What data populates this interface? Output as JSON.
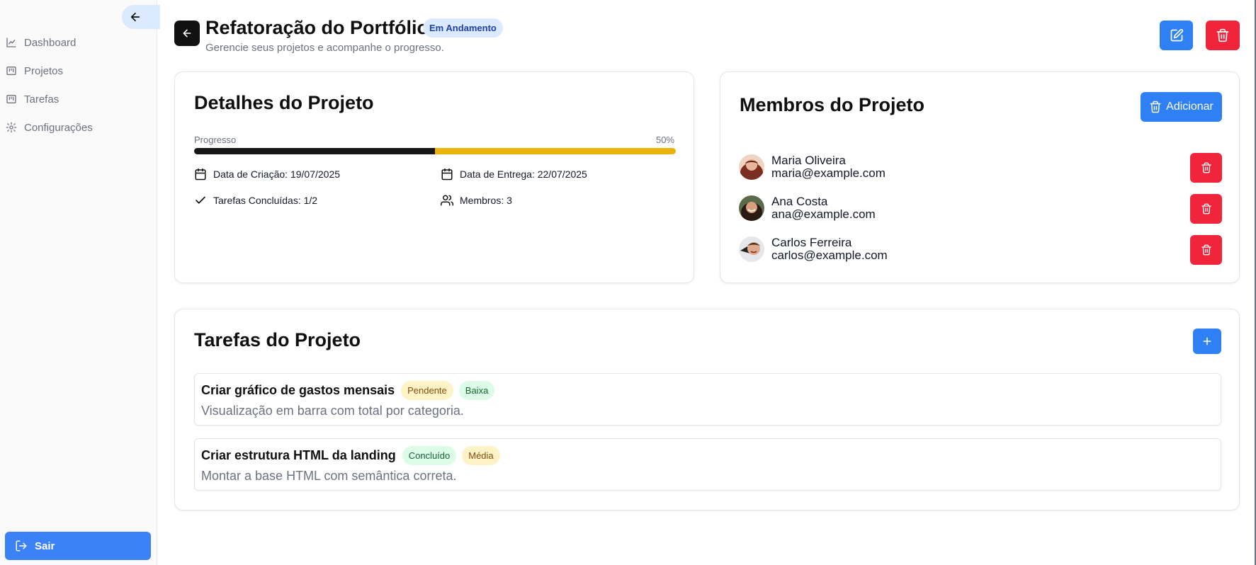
{
  "sidebar": {
    "items": [
      {
        "label": "Dashboard",
        "icon": "chart-line-icon"
      },
      {
        "label": "Projetos",
        "icon": "kanban-icon"
      },
      {
        "label": "Tarefas",
        "icon": "kanban-icon"
      },
      {
        "label": "Configurações",
        "icon": "gear-icon"
      }
    ],
    "logout_label": "Sair"
  },
  "header": {
    "title": "Refatoração do Portfólio",
    "status": "Em Andamento",
    "subtitle": "Gerencie seus projetos e acompanhe o progresso."
  },
  "details": {
    "title": "Detalhes do Projeto",
    "progress_label": "Progresso",
    "progress_text": "50%",
    "progress": 0.5,
    "created": "Data de Criação: 19/07/2025",
    "due": "Data de Entrega: 22/07/2025",
    "tasks_done": "Tarefas Concluídas: 1/2",
    "members": "Membros: 3"
  },
  "members": {
    "title": "Membros do Projeto",
    "add_label": "Adicionar",
    "list": [
      {
        "name": "Maria Oliveira",
        "email": "maria@example.com"
      },
      {
        "name": "Ana Costa",
        "email": "ana@example.com"
      },
      {
        "name": "Carlos Ferreira",
        "email": "carlos@example.com"
      }
    ]
  },
  "tasks": {
    "title": "Tarefas do Projeto",
    "list": [
      {
        "title": "Criar gráfico de gastos mensais",
        "status": "Pendente",
        "priority": "Baixa",
        "description": "Visualização em barra com total por categoria."
      },
      {
        "title": "Criar estrutura HTML da landing",
        "status": "Concluído",
        "priority": "Média",
        "description": "Montar a base HTML com semântica correta."
      }
    ]
  },
  "colors": {
    "primary": "#2f80f5",
    "danger": "#f0253b",
    "progress_track": "#eab308",
    "progress_fill": "#171717"
  }
}
